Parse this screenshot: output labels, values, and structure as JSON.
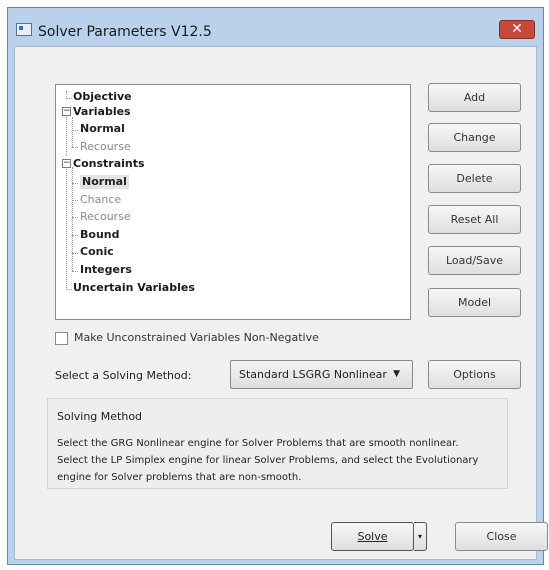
{
  "window": {
    "title": "Solver Parameters V12.5",
    "close_glyph": "✕"
  },
  "tree": {
    "items": [
      {
        "label": "Objective"
      },
      {
        "label": "Variables"
      },
      {
        "label": "Normal"
      },
      {
        "label": "Recourse"
      },
      {
        "label": "Constraints"
      },
      {
        "label": "Normal"
      },
      {
        "label": "Chance"
      },
      {
        "label": "Recourse"
      },
      {
        "label": "Bound"
      },
      {
        "label": "Conic"
      },
      {
        "label": "Integers"
      },
      {
        "label": "Uncertain Variables"
      }
    ],
    "expander_glyph": "−"
  },
  "buttons": {
    "add": "Add",
    "change": "Change",
    "delete": "Delete",
    "reset_all": "Reset All",
    "load_save": "Load/Save",
    "model": "Model",
    "options": "Options",
    "solve": "Solve",
    "close": "Close"
  },
  "checkbox": {
    "label": "Make Unconstrained Variables Non-Negative",
    "checked": false
  },
  "solving": {
    "label": "Select a Solving Method:",
    "selected": "Standard LSGRG Nonlinear",
    "caret": "▼"
  },
  "method_box": {
    "title": "Solving Method",
    "line1": "Select the GRG Nonlinear engine for Solver Problems that are smooth nonlinear.",
    "line2": "Select the LP Simplex engine for linear Solver Problems, and select the Evolutionary",
    "line3": "engine for Solver problems that are non-smooth."
  },
  "solve_dropdown_glyph": "▾"
}
